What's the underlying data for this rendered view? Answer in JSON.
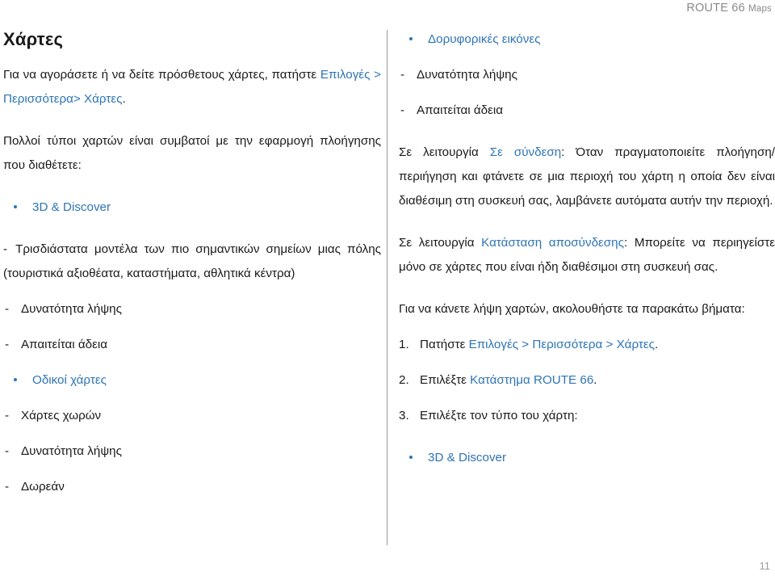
{
  "header": {
    "title_main": "ROUTE 66 ",
    "title_smallcaps": "Maps"
  },
  "footer": {
    "page_number": "11"
  },
  "colors": {
    "link": "#2e74b5",
    "header_gray": "#8a8a8a",
    "divider": "#9a9a9a",
    "body_text": "#1a1a1a"
  },
  "left_column": {
    "title": "Χάρτες",
    "intro_paragraph": {
      "text_before": "Για να αγοράσετε ή να δείτε πρόσθετους χάρτες, πατήστε ",
      "link": "Επιλογές > Περισσότερα> Χάρτες",
      "text_after": "."
    },
    "types_intro": "Πολλοί τύποι χαρτών είναι συμβατοί με την εφαρμογή πλοήγησης που διαθέτετε:",
    "items": [
      {
        "kind": "bullet",
        "label": "3D & Discover"
      },
      {
        "kind": "dash",
        "label": "Τρισδιάστατα μοντέλα των πιο σημαντικών σημείων μιας πόλης (τουριστικά αξιοθέατα, καταστήματα, αθλητικά κέντρα)"
      },
      {
        "kind": "dash",
        "label": "Δυνατότητα λήψης"
      },
      {
        "kind": "dash",
        "label": "Απαιτείται άδεια"
      },
      {
        "kind": "bullet",
        "label": "Οδικοί χάρτες"
      },
      {
        "kind": "dash",
        "label": "Χάρτες χωρών"
      },
      {
        "kind": "dash",
        "label": "Δυνατότητα λήψης"
      },
      {
        "kind": "dash",
        "label": "Δωρεάν"
      }
    ]
  },
  "right_column": {
    "items": [
      {
        "kind": "bullet",
        "label": "Δορυφορικές εικόνες"
      },
      {
        "kind": "dash",
        "label": "Δυνατότητα λήψης"
      },
      {
        "kind": "dash",
        "label": "Απαιτείται άδεια"
      }
    ],
    "online_paragraph": {
      "text_before": "Σε λειτουργία ",
      "link": "Σε σύνδεση",
      "text_after": ": Όταν πραγματοποιείτε πλοήγηση/ περιήγηση και φτάνετε σε μια περιοχή του χάρτη η οποία δεν είναι διαθέσιμη στη συσκευή σας, λαμβάνετε αυτόματα αυτήν την περιοχή."
    },
    "offline_paragraph": {
      "text_before": "Σε λειτουργία ",
      "link": "Κατάσταση αποσύνδεσης",
      "text_after": ": Μπορείτε να περιηγείστε μόνο σε χάρτες που είναι ήδη διαθέσιμοι στη συσκευή σας."
    },
    "steps_intro": "Για να κάνετε λήψη χαρτών, ακολουθήστε τα παρακάτω βήματα:",
    "steps": [
      {
        "number": "1.",
        "text_before": "Πατήστε ",
        "link": "Επιλογές > Περισσότερα > Χάρτες",
        "text_after": "."
      },
      {
        "number": "2.",
        "text_before": "Επιλέξτε ",
        "link": "Κατάστημα ROUTE 66",
        "text_after": "."
      },
      {
        "number": "3.",
        "text_before": "Επιλέξτε τον τύπο του χάρτη:",
        "link": "",
        "text_after": ""
      }
    ],
    "final_bullet": {
      "kind": "bullet",
      "label": "3D & Discover"
    }
  }
}
